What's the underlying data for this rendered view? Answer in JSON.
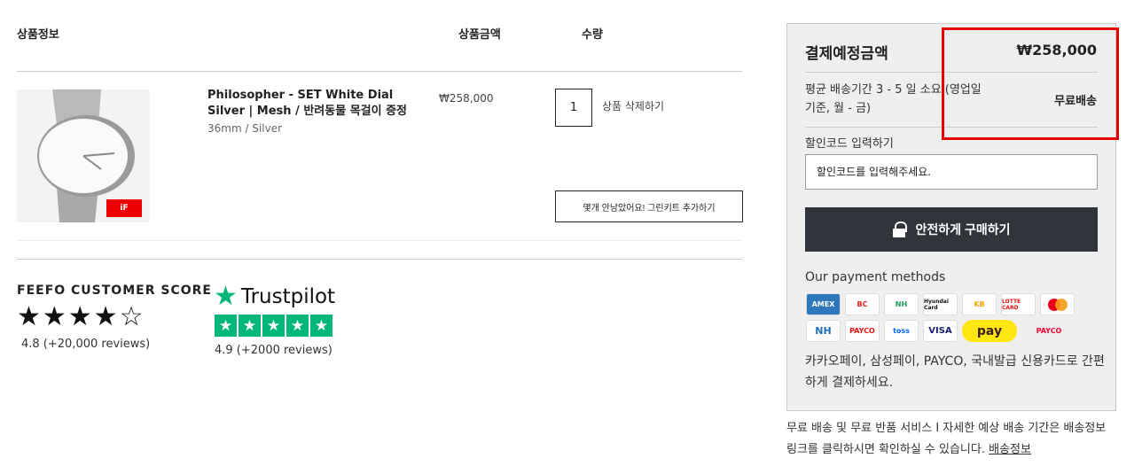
{
  "cart_header": {
    "product_info": "상품정보",
    "price": "상품금액",
    "quantity": "수량"
  },
  "product": {
    "name": "Philosopher - SET White Dial Silver | Mesh / 반려동물 목걸이 증정",
    "variant": "36mm / Silver",
    "price": "₩258,000",
    "quantity": "1",
    "delete_label": "상품 삭제하기",
    "gift_button": "몇개 안남았어요! 그린키트 추가하기",
    "award_badge": "iF"
  },
  "reviews": {
    "feefo_title": "FEEFO CUSTOMER SCORE",
    "feefo_stars": "★★★★☆",
    "feefo_score": "4.8  (+20,000 reviews)",
    "trustpilot_name": "Trustpilot",
    "trustpilot_score": "4.9  (+2000 reviews)"
  },
  "summary": {
    "title": "결제예정금액",
    "total": "₩258,000",
    "shipping_estimate": "평균 배송기간 3 - 5 일 소요 (영업일 기준, 월 - 금)",
    "shipping_fee": "무료배송",
    "discount_label": "할인코드 입력하기",
    "discount_placeholder": "할인코드를 입력해주세요.",
    "buy_button": "안전하게 구매하기",
    "payment_title": "Our payment methods",
    "payment_methods": [
      "AMEX",
      "BC",
      "NH",
      "Hyundai Card",
      "KB",
      "LOTTE CARD",
      "MasterCard",
      "NH",
      "PAYCO",
      "toss",
      "VISA",
      "pay",
      "PAYCO"
    ],
    "payment_desc": "카카오페이, 삼성페이, PAYCO, 국내발급 신용카드로 간편하게 결제하세요."
  },
  "footer": {
    "note": "무료 배송 및 무료 반품 서비스 I 자세한 예상 배송 기간은 배송정보 링크를 클릭하시면 확인하실 수 있습니다.",
    "link": "배송정보"
  },
  "colors": {
    "buy_button_bg": "#2f353b",
    "trustpilot_green": "#00b67a",
    "highlight_red": "#e60000",
    "kakao_yellow": "#ffe812"
  }
}
